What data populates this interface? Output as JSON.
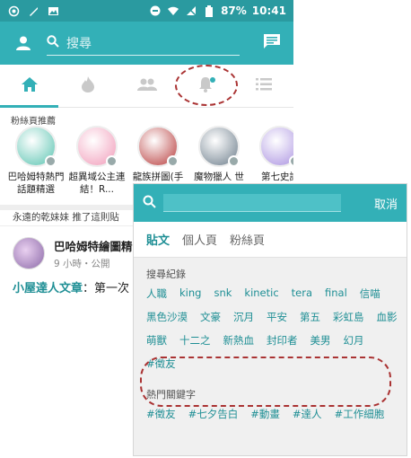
{
  "status_bar": {
    "battery": "87%",
    "time": "10:41"
  },
  "app_bar": {
    "search_placeholder": "搜尋"
  },
  "fan_pages": {
    "section_title": "粉絲頁推薦",
    "items": [
      {
        "name": "巴哈姆特熱門話題精選",
        "color": "#58c3b0"
      },
      {
        "name": "超異域公主連結！R...",
        "color": "#f19ab8"
      },
      {
        "name": "龍族拼圖(手",
        "color": "#b73a3a"
      },
      {
        "name": "魔物獵人 世",
        "color": "#6b7c8a"
      },
      {
        "name": "第七史詩",
        "color": "#a88fe0"
      }
    ]
  },
  "reco_line": "永遠的乾妹妹 推了這則貼",
  "post": {
    "author": "巴哈姆特繪圖精",
    "meta": "9 小時・公開",
    "body_highlight": "小屋達人文章",
    "body_rest": "：第一次"
  },
  "search_overlay": {
    "cancel_label": "取消",
    "tabs": [
      "貼文",
      "個人頁",
      "粉絲頁"
    ],
    "history_label": "搜尋紀錄",
    "history": [
      "人職",
      "king",
      "snk",
      "kinetic",
      "tera",
      "final",
      "信喵",
      "黑色沙漠",
      "文豪",
      "沉月",
      "平安",
      "第五",
      "彩虹島",
      "血影",
      "萌獸",
      "十二之",
      "新熱血",
      "封印者",
      "美男",
      "幻月",
      "#徵友"
    ],
    "hot_label": "熱門關鍵字",
    "hot": [
      "#徵友",
      "#七夕告白",
      "#動畫",
      "#達人",
      "#工作細胞"
    ]
  },
  "colors": {
    "accent": "#33b0b7",
    "dark_accent": "#2a9aa0",
    "keyword": "#1f8f95"
  }
}
